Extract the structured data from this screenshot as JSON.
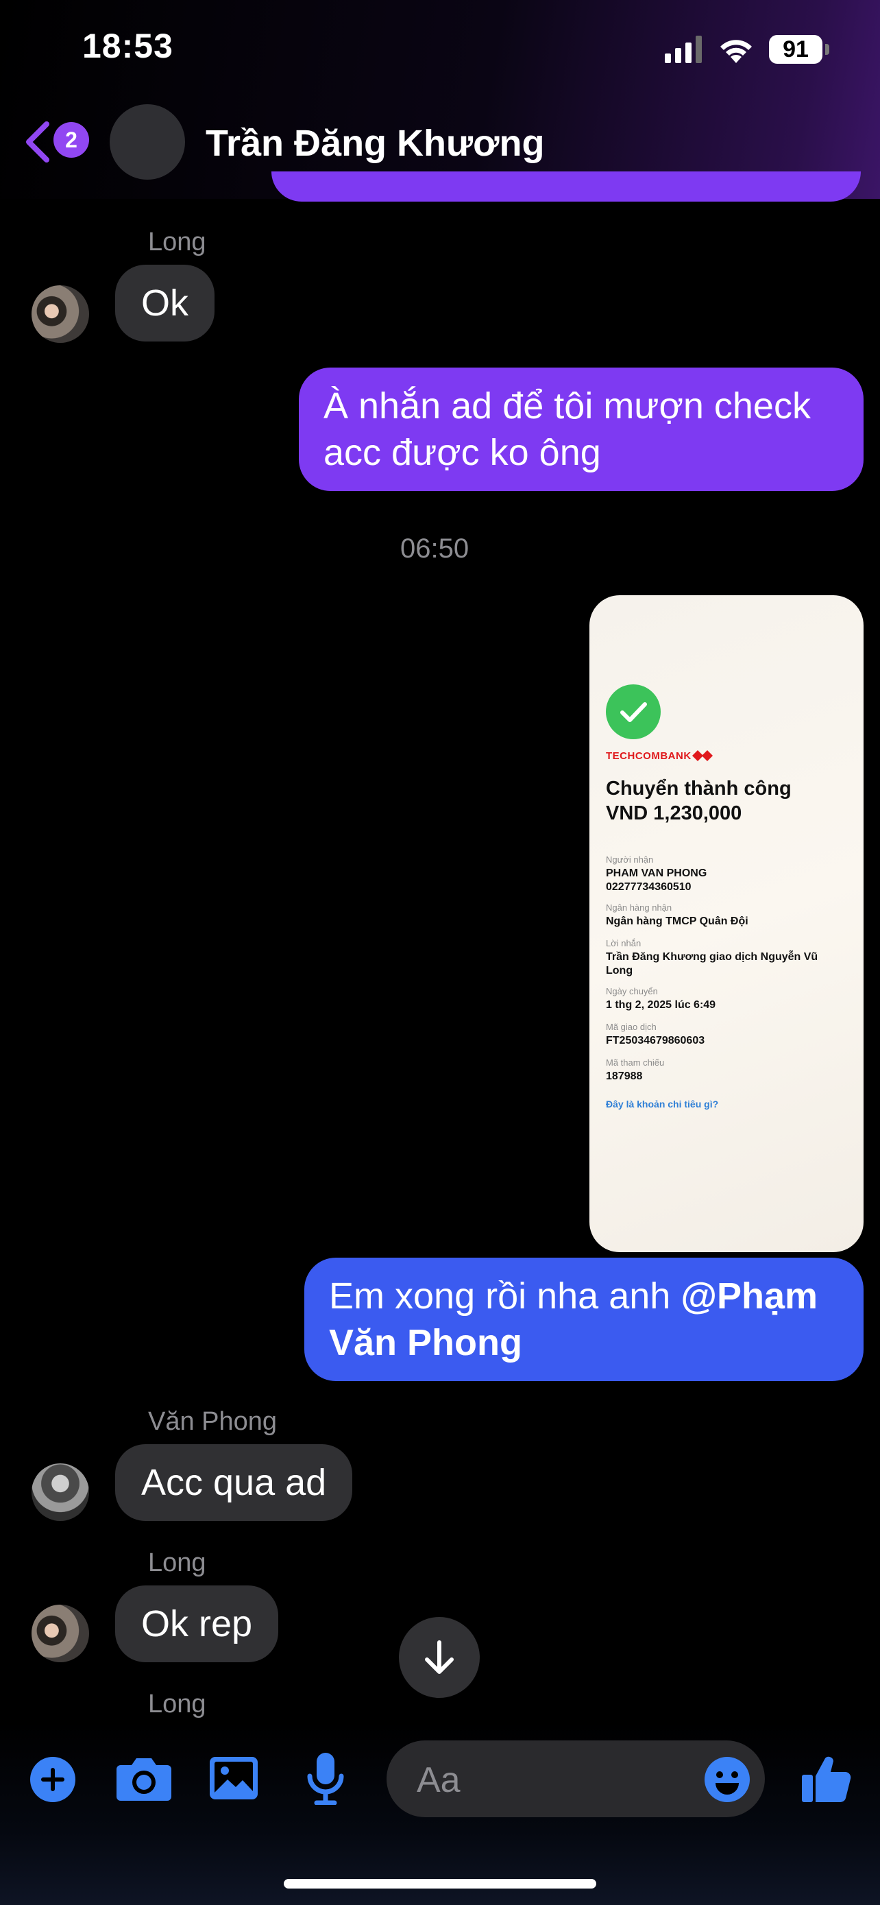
{
  "status_bar": {
    "time": "18:53",
    "battery": "91"
  },
  "header": {
    "unread_count": "2",
    "contact_name": "Trần Đăng Khương"
  },
  "messages": [
    {
      "sender": "Long",
      "text": "Ok"
    },
    {
      "text": "À nhắn ad để tôi mượn check acc được ko ông"
    },
    {
      "timestamp": "06:50"
    },
    {
      "text_plain": "Em xong rồi nha anh ",
      "mention": "@Phạm Văn Phong"
    },
    {
      "sender": "Văn Phong",
      "text": "Acc qua ad"
    },
    {
      "sender": "Long",
      "text": "Ok rep"
    },
    {
      "sender": "Long"
    }
  ],
  "receipt": {
    "bank": "TECHCOMBANK",
    "title": "Chuyển thành công",
    "amount": "VND 1,230,000",
    "fields": [
      {
        "label": "Người nhận",
        "value": "PHAM VAN PHONG\n02277734360510"
      },
      {
        "label": "Ngân hàng nhận",
        "value": "Ngân hàng TMCP Quân Đội"
      },
      {
        "label": "Lời nhắn",
        "value": "Trần Đăng Khương giao dịch Nguyễn Vũ Long"
      },
      {
        "label": "Ngày chuyển",
        "value": "1 thg 2, 2025 lúc 6:49"
      },
      {
        "label": "Mã giao dịch",
        "value": "FT25034679860603"
      },
      {
        "label": "Mã tham chiếu",
        "value": "187988"
      }
    ],
    "link": "Đây là khoản chi tiêu gì?"
  },
  "composer": {
    "placeholder": "Aa"
  },
  "colors": {
    "accent": "#3b82f6",
    "purple_bubble": "#7e3af2",
    "blue_bubble": "#3b5bf0"
  }
}
